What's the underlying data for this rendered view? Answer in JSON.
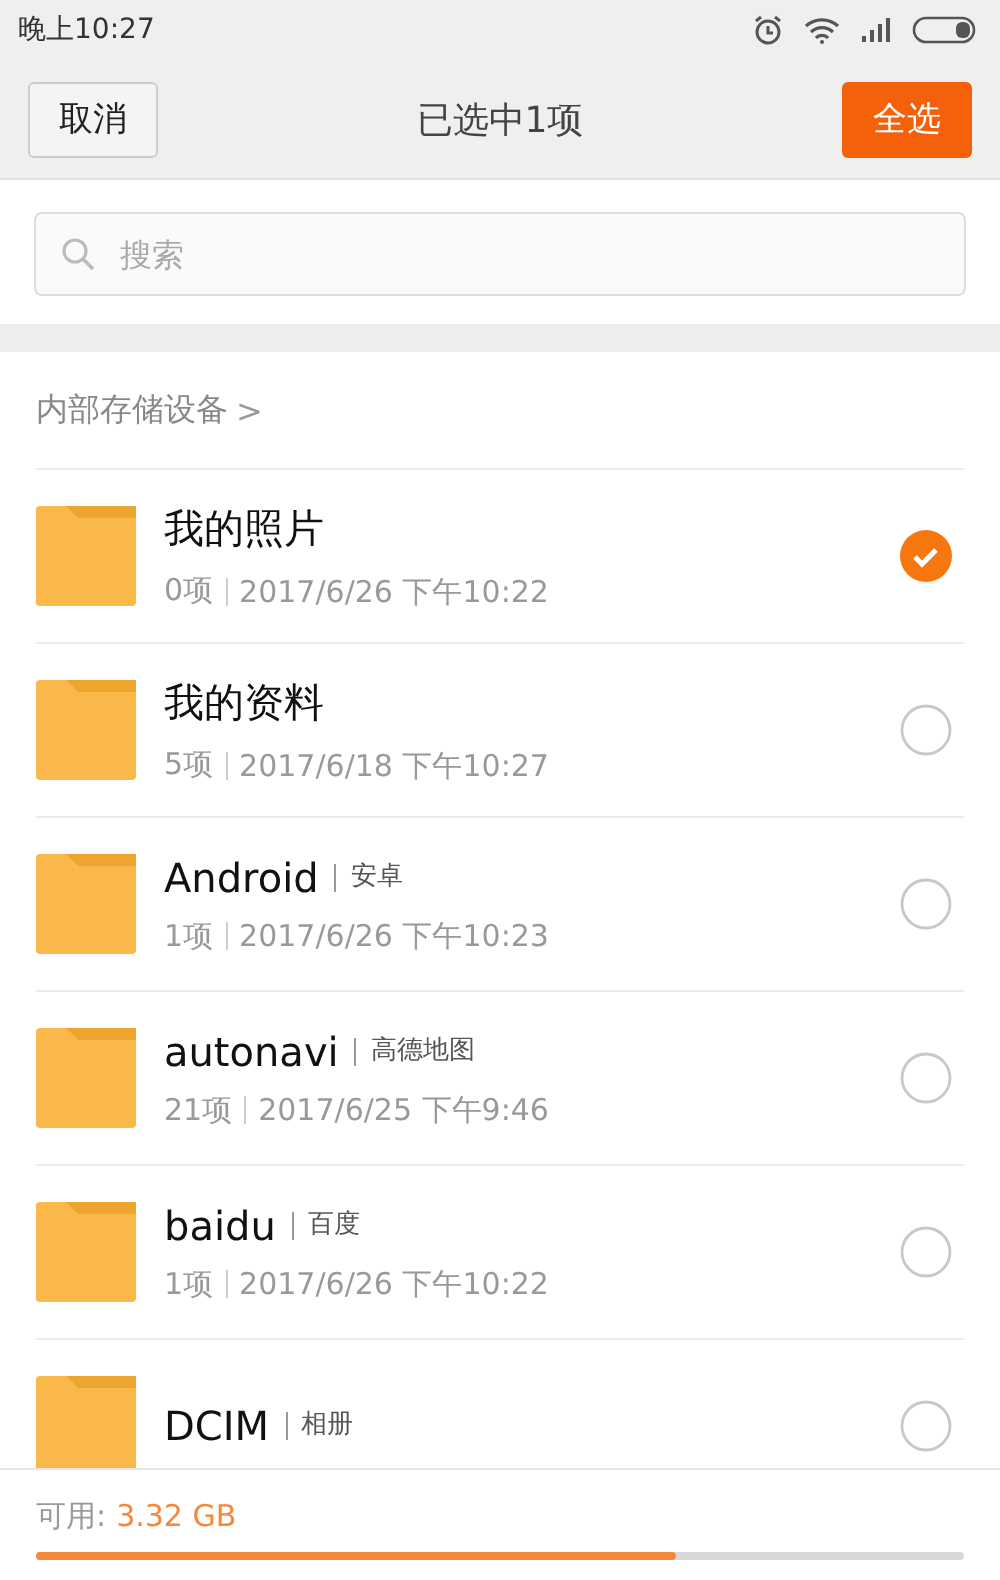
{
  "status_bar": {
    "time": "晚上10:27"
  },
  "header": {
    "cancel": "取消",
    "title": "已选中1项",
    "select_all": "全选"
  },
  "search": {
    "placeholder": "搜索"
  },
  "breadcrumb": {
    "label": "内部存储设备",
    "chevron": ">"
  },
  "folders": [
    {
      "name": "我的照片",
      "meta": "0项",
      "date": "2017/6/26 下午10:22",
      "selected": true
    },
    {
      "name": "我的资料",
      "meta": "5项",
      "date": "2017/6/18 下午10:27",
      "selected": false
    },
    {
      "name": "Android",
      "alias": "安卓",
      "meta": "1项",
      "date": "2017/6/26 下午10:23",
      "selected": false
    },
    {
      "name": "autonavi",
      "alias": "高德地图",
      "meta": "21项",
      "date": "2017/6/25 下午9:46",
      "selected": false
    },
    {
      "name": "baidu",
      "alias": "百度",
      "meta": "1项",
      "date": "2017/6/26 下午10:22",
      "selected": false
    },
    {
      "name": "DCIM",
      "alias": "相册",
      "selected": false
    }
  ],
  "storage": {
    "available_label": "可用:",
    "available": "3.32 GB",
    "level": 0.69
  }
}
